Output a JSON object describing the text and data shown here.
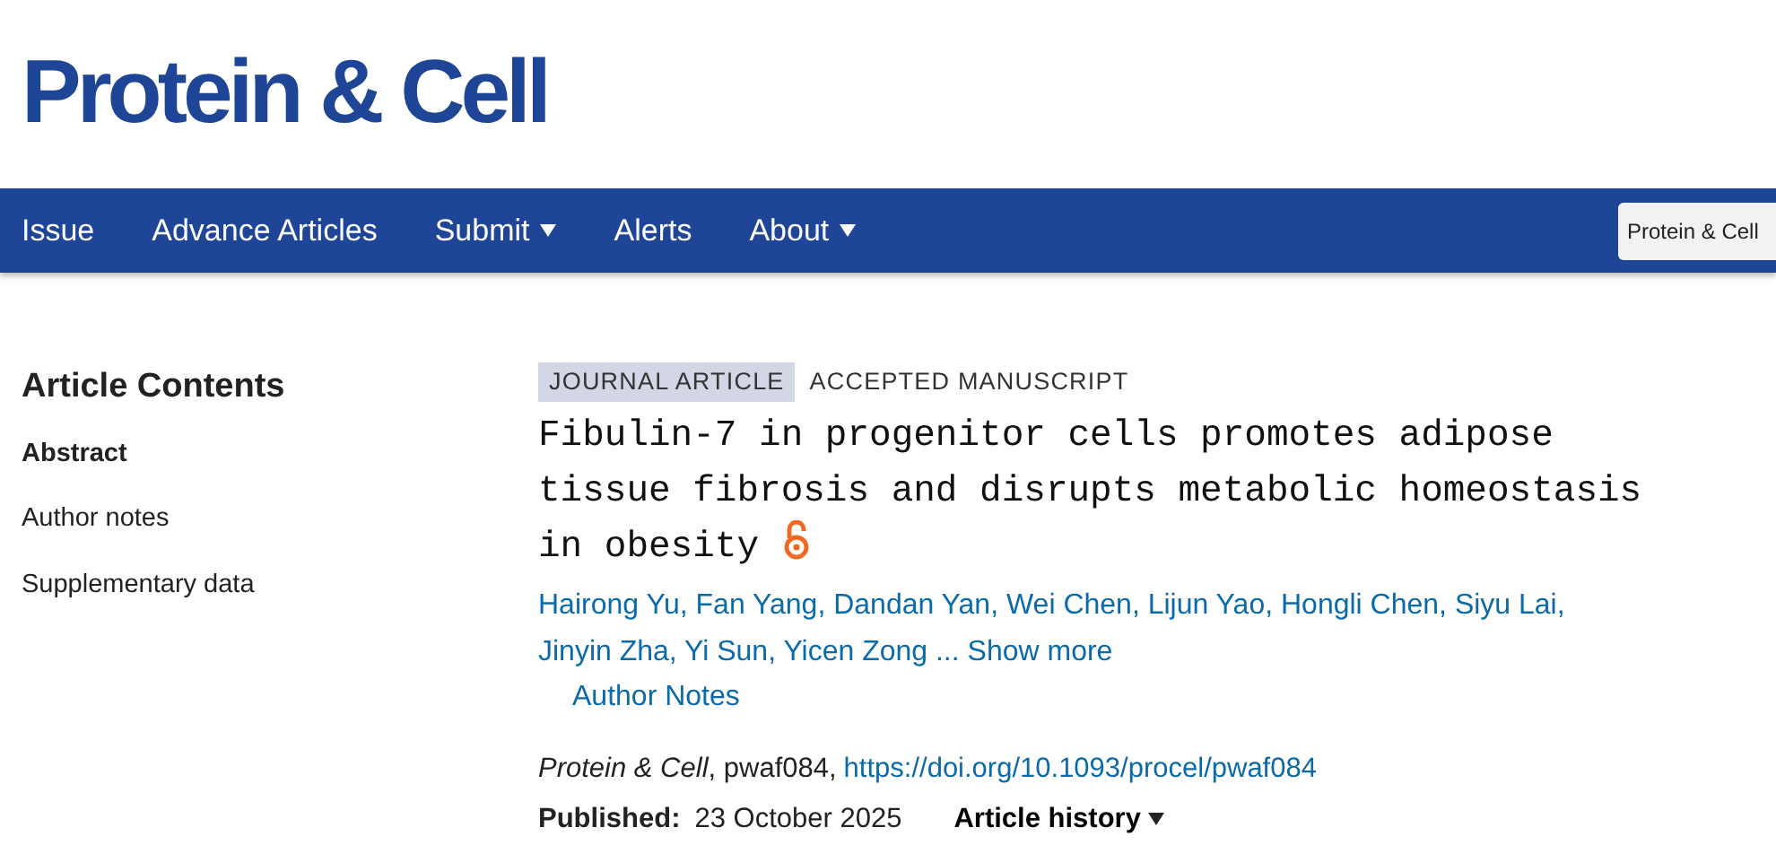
{
  "logo": "Protein & Cell",
  "nav": [
    {
      "label": "Issue",
      "has_menu": false
    },
    {
      "label": "Advance Articles",
      "has_menu": false
    },
    {
      "label": "Submit",
      "has_menu": true
    },
    {
      "label": "Alerts",
      "has_menu": false
    },
    {
      "label": "About",
      "has_menu": true
    }
  ],
  "search_scope": {
    "value": "Protein & Cell"
  },
  "sidebar": {
    "title": "Article Contents",
    "items": [
      {
        "label": "Abstract",
        "selected": true
      },
      {
        "label": "Author notes",
        "selected": false
      },
      {
        "label": "Supplementary data",
        "selected": false
      }
    ]
  },
  "article": {
    "type_tag": "JOURNAL ARTICLE",
    "status": "ACCEPTED MANUSCRIPT",
    "title": "Fibulin-7 in progenitor cells promotes adipose tissue fibrosis and disrupts metabolic homeostasis in obesity",
    "open_access": true,
    "authors": [
      "Hairong Yu,",
      "Fan Yang,",
      "Dandan Yan,",
      "Wei Chen,",
      "Lijun Yao,",
      "Hongli Chen,",
      "Siyu Lai,",
      "Jinyin Zha,",
      "Yi Sun,",
      "Yicen Zong ..."
    ],
    "show_more": "Show more",
    "author_notes": "Author Notes",
    "citation": "*Protein & Cell*, pwaf084,",
    "doi": "https://doi.org/10.1093/procel/pwaf084",
    "published_label": "Published:",
    "published_date": "23 October 2025",
    "history": "Article history"
  }
}
